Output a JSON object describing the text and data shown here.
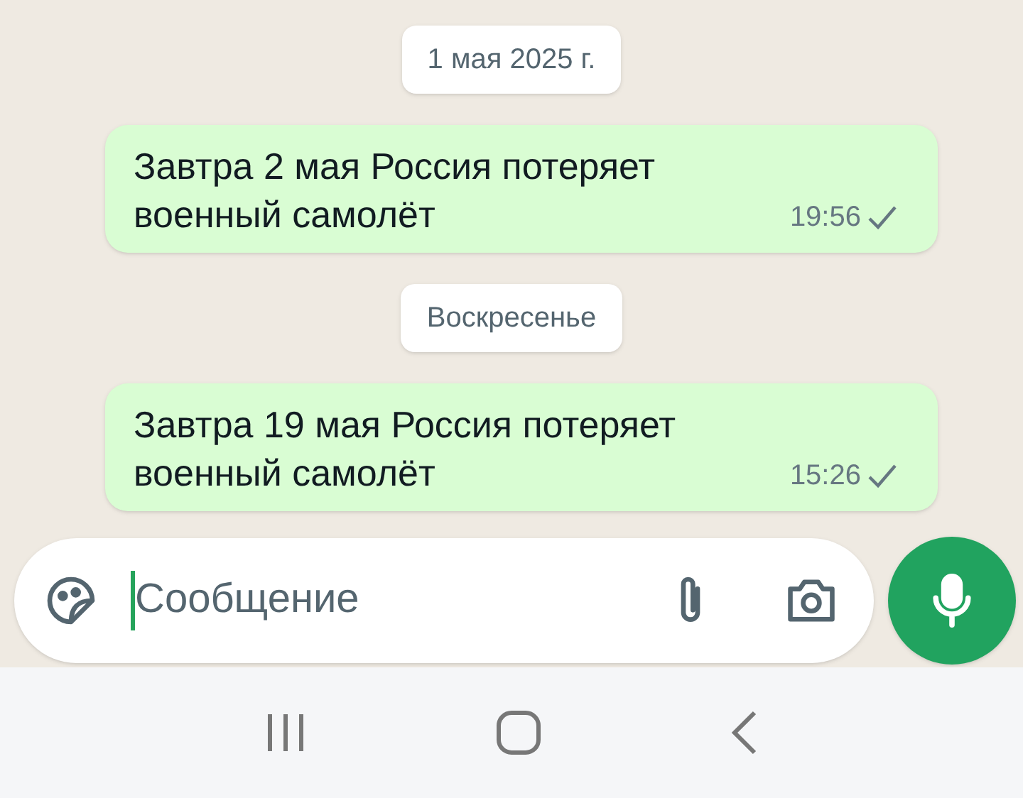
{
  "messages": [
    {
      "kind": "date",
      "text": "1 мая 2025 г."
    },
    {
      "kind": "outgoing",
      "text": "Завтра 2 мая Россия потеряет военный самолёт",
      "time": "19:56",
      "read": false
    },
    {
      "kind": "date",
      "text": "Воскресенье"
    },
    {
      "kind": "outgoing",
      "text": "Завтра 19 мая Россия потеряет военный самолёт",
      "time": "15:26",
      "read": false
    }
  ],
  "composer": {
    "placeholder": "Сообщение"
  }
}
